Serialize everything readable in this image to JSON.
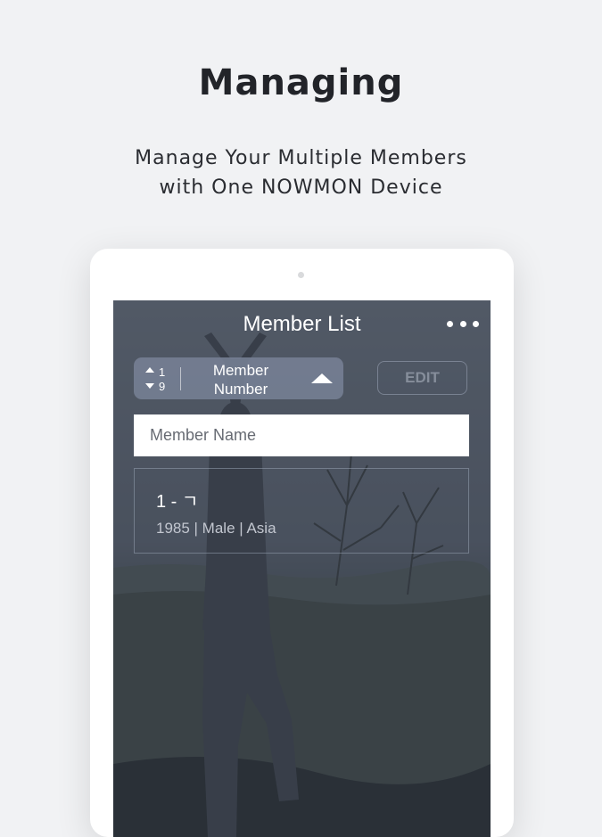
{
  "promo": {
    "headline": "Managing",
    "subline_1": "Manage Your Multiple Members",
    "subline_2": "with One NOWMON Device"
  },
  "app": {
    "title": "Member List",
    "menu_icon": "more-horizontal-icon",
    "sort": {
      "icon": "sort-order-icon",
      "icon_top": "1",
      "icon_bottom": "9",
      "label_line_1": "Member",
      "label_line_2": "Number",
      "direction_icon": "caret-up-icon"
    },
    "edit_label": "EDIT",
    "search": {
      "placeholder": "Member Name",
      "value": ""
    },
    "members": [
      {
        "name": "1 - ㄱ",
        "info": "1985 | Male | Asia"
      }
    ]
  },
  "colors": {
    "page_background": "#f1f2f4",
    "tablet_frame": "#ffffff",
    "screen_overlay": "#2d3442",
    "sort_control": "#768093"
  }
}
